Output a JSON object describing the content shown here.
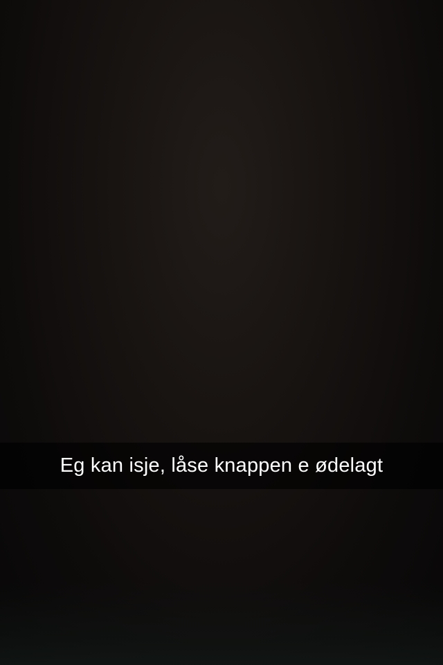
{
  "snap": {
    "caption": "Eg kan isje, låse knappen e ødelagt"
  },
  "colors": {
    "background": "#0d0b0b",
    "caption_bar": "#000000",
    "caption_text": "#ffffff"
  }
}
